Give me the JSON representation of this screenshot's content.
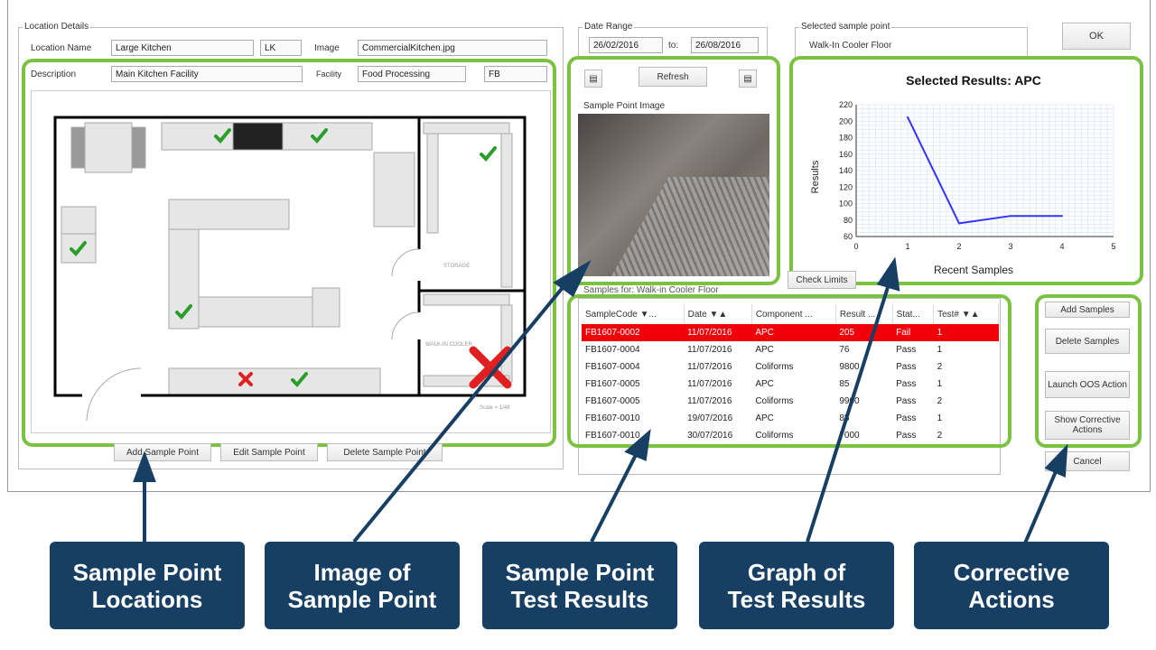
{
  "location_details": {
    "legend": "Location Details",
    "name_label": "Location Name",
    "name_value": "Large Kitchen",
    "code_value": "LK",
    "image_label": "Image",
    "image_value": "CommercialKitchen.jpg",
    "description_label": "Description",
    "description_value": "Main Kitchen Facility",
    "facility_label": "Facility",
    "facility_value": "Food Processing",
    "facility_code": "FB"
  },
  "floor_plan": {
    "storage_label": "STORAGE",
    "cooler_label": "WALK-IN COOLER",
    "scale_label": "Scale = 1/48"
  },
  "sample_point_buttons": [
    "Add Sample Point",
    "Edit Sample Point",
    "Delete Sample Point"
  ],
  "date_range": {
    "legend": "Date Range",
    "from": "26/02/2016",
    "to_label": "to:",
    "to": "26/08/2016"
  },
  "image_panel": {
    "refresh_label": "Refresh",
    "title": "Sample Point Image"
  },
  "selected_point": {
    "legend": "Selected sample point",
    "value": "Walk-In Cooler Floor"
  },
  "ok_label": "OK",
  "check_limits_label": "Check Limits",
  "samples_for_label": "Samples for:  Walk-in Cooler Floor",
  "results_table": {
    "columns": [
      "SampleCode ▼...",
      "Date ▼▲",
      "Component ...",
      "Result ...",
      "Stat...",
      "Test# ▼▲"
    ],
    "rows": [
      [
        "FB1607-0002",
        "11/07/2016",
        "APC",
        "205",
        "Fail",
        "1"
      ],
      [
        "FB1607-0004",
        "11/07/2016",
        "APC",
        "76",
        "Pass",
        "1"
      ],
      [
        "FB1607-0004",
        "11/07/2016",
        "Coliforms",
        "9800",
        "Pass",
        "2"
      ],
      [
        "FB1607-0005",
        "11/07/2016",
        "APC",
        "85",
        "Pass",
        "1"
      ],
      [
        "FB1607-0005",
        "11/07/2016",
        "Coliforms",
        "9900",
        "Pass",
        "2"
      ],
      [
        "FB1607-0010",
        "19/07/2016",
        "APC",
        "85",
        "Pass",
        "1"
      ],
      [
        "FB1607-0010",
        "30/07/2016",
        "Coliforms",
        "7000",
        "Pass",
        "2"
      ]
    ],
    "fail_color": "#f2000a"
  },
  "action_buttons": {
    "add": "Add Samples",
    "delete": "Delete Samples",
    "launch": "Launch OOS Action",
    "show": "Show Corrective Actions",
    "cancel": "Cancel"
  },
  "chart_data": {
    "type": "line",
    "title": "Selected Results: APC",
    "xlabel": "Recent Samples",
    "ylabel": "Results",
    "xlim": [
      0,
      5
    ],
    "ylim": [
      60,
      220
    ],
    "xticks": [
      0,
      1,
      2,
      3,
      4,
      5
    ],
    "yticks": [
      60,
      80,
      100,
      120,
      140,
      160,
      180,
      200,
      220
    ],
    "grid": true,
    "x": [
      1,
      2,
      3,
      4
    ],
    "values": [
      205,
      76,
      85,
      85
    ],
    "line_color": "#3333ff"
  },
  "callouts": [
    {
      "line1": "Sample Point",
      "line2": "Locations"
    },
    {
      "line1": "Image of",
      "line2": "Sample Point"
    },
    {
      "line1": "Sample Point",
      "line2": "Test Results"
    },
    {
      "line1": "Graph of",
      "line2": "Test Results"
    },
    {
      "line1": "Corrective",
      "line2": "Actions"
    }
  ],
  "colors": {
    "highlight": "#7cc242",
    "callout": "#173f63",
    "check": "#2a9d2a",
    "cross": "#e02020"
  }
}
